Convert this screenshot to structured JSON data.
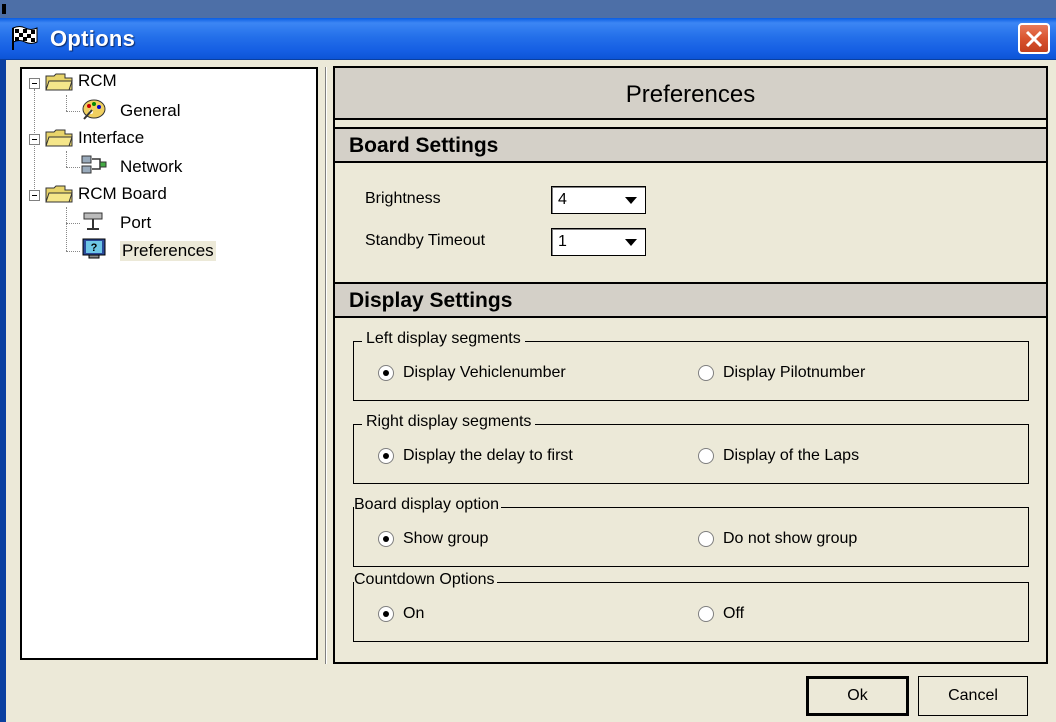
{
  "window": {
    "title": "Options",
    "close_label": "×"
  },
  "tree": {
    "items": [
      {
        "label": "RCM",
        "icon": "folder-icon",
        "level": 0,
        "expanded": true
      },
      {
        "label": "General",
        "icon": "palette-icon",
        "level": 1
      },
      {
        "label": "Interface",
        "icon": "folder-icon",
        "level": 0,
        "expanded": true
      },
      {
        "label": "Network",
        "icon": "network-icon",
        "level": 1
      },
      {
        "label": "RCM Board",
        "icon": "folder-icon",
        "level": 0,
        "expanded": true
      },
      {
        "label": "Port",
        "icon": "port-icon",
        "level": 1
      },
      {
        "label": "Preferences",
        "icon": "help-monitor-icon",
        "level": 1,
        "selected": true
      }
    ]
  },
  "panel": {
    "title": "Preferences",
    "board_settings": {
      "heading": "Board Settings",
      "brightness_label": "Brightness",
      "brightness_value": "4",
      "standby_label": "Standby Timeout",
      "standby_value": "1"
    },
    "display_settings": {
      "heading": "Display Settings",
      "groups": [
        {
          "legend": "Left display segments",
          "option_a": "Display Vehiclenumber",
          "option_b": "Display Pilotnumber",
          "selected": "a"
        },
        {
          "legend": "Right display segments",
          "option_a": "Display the delay to first",
          "option_b": "Display of the Laps",
          "selected": "a"
        },
        {
          "legend": "Board display option",
          "option_a": "Show group",
          "option_b": "Do not show group",
          "selected": "a"
        },
        {
          "legend": "Countdown Options",
          "option_a": "On",
          "option_b": "Off",
          "selected": "a"
        }
      ]
    }
  },
  "buttons": {
    "ok": "Ok",
    "cancel": "Cancel"
  },
  "colors": {
    "titlebar": "#2470ea",
    "panel_bg": "#ece9d8",
    "section_bg": "#d4d0c8",
    "close_button": "#d9532e"
  }
}
